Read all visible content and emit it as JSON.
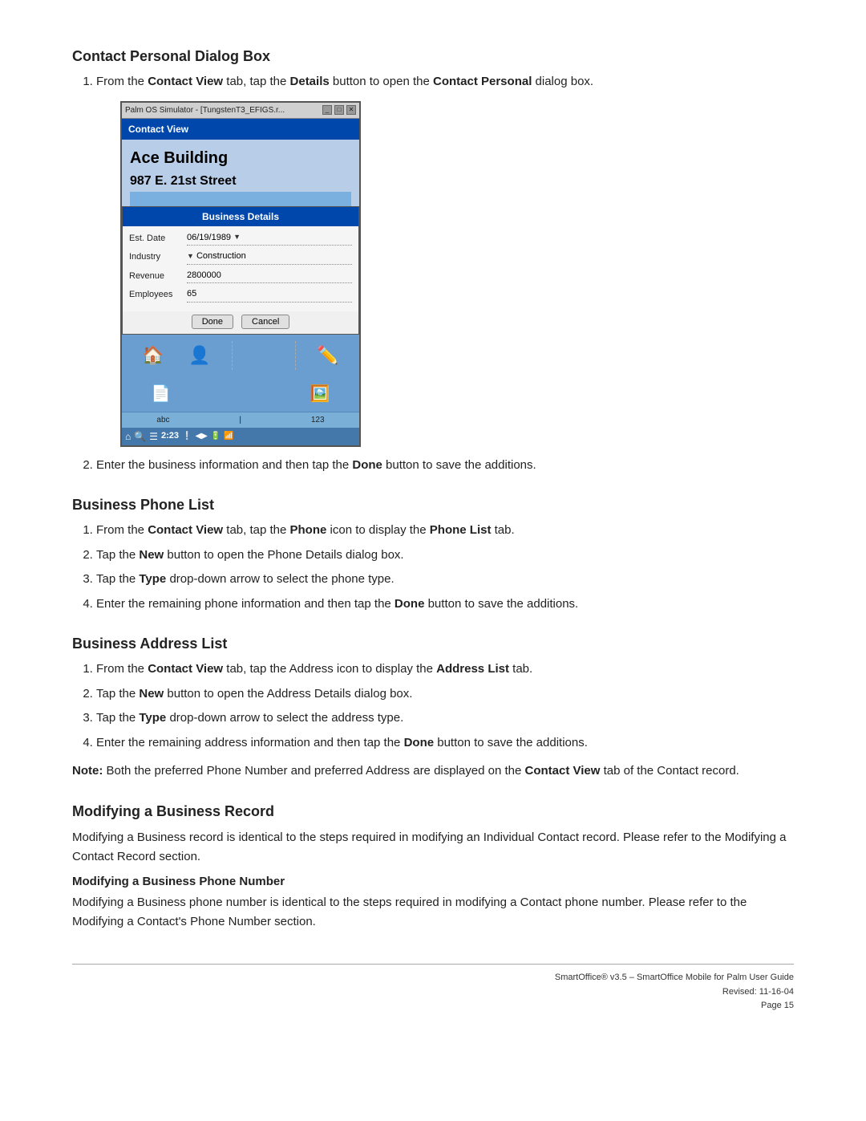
{
  "sections": {
    "contact_personal_dialog": {
      "title": "Contact Personal Dialog Box",
      "steps": [
        {
          "text_before": "From the ",
          "bold1": "Contact View",
          "text_mid1": " tab, tap the ",
          "bold2": "Details",
          "text_mid2": " button to open the ",
          "bold3": "Contact Personal",
          "text_after": " dialog box."
        },
        {
          "text": "Enter the business information and then tap the ",
          "bold": "Done",
          "text_after": " button to save the additions."
        }
      ]
    },
    "business_phone_list": {
      "title": "Business Phone List",
      "steps": [
        {
          "text": "From the ",
          "bold1": "Contact View",
          "text_mid": " tab, tap the ",
          "bold2": "Phone",
          "text_mid2": " icon to display the ",
          "bold3": "Phone List",
          "text_after": " tab."
        },
        {
          "text": "Tap the ",
          "bold": "New",
          "text_after": " button to open the Phone Details dialog box."
        },
        {
          "text": "Tap the ",
          "bold": "Type",
          "text_after": " drop-down arrow to select the phone type."
        },
        {
          "text": "Enter the remaining phone information and then tap the ",
          "bold": "Done",
          "text_after": " button to save the additions."
        }
      ]
    },
    "business_address_list": {
      "title": "Business Address List",
      "steps": [
        {
          "text": "From the ",
          "bold1": "Contact View",
          "text_mid": " tab, tap the Address icon to display the ",
          "bold2": "Address List",
          "text_after": " tab."
        },
        {
          "text": "Tap the ",
          "bold": "New",
          "text_after": " button to open the Address Details dialog box."
        },
        {
          "text": "Tap the ",
          "bold": "Type",
          "text_after": " drop-down arrow to select the address type."
        },
        {
          "text": "Enter the remaining address information and then tap the ",
          "bold": "Done",
          "text_after": " button to save the additions."
        }
      ],
      "note": {
        "label": "Note:",
        "text": " Both the preferred Phone Number and preferred Address are displayed on the ",
        "bold": "Contact View",
        "text_after": " tab of the Contact record."
      }
    },
    "modifying_business_record": {
      "title": "Modifying a Business Record",
      "body": "Modifying a Business record is identical to the steps required in modifying an Individual Contact record. Please refer to the Modifying a Contact Record section.",
      "subsection": {
        "title": "Modifying a Business Phone Number",
        "body": "Modifying a Business phone number is identical to the steps required in modifying a Contact phone number. Please refer to the Modifying a Contact's Phone Number section."
      }
    }
  },
  "palm_simulator": {
    "titlebar": "Palm OS Simulator - [TungstenT3_EFIGS.r...",
    "tab": "Contact View",
    "contact_name": "Ace Building",
    "contact_address": "987 E. 21st Street",
    "contact_city": "▄▄▄▄▄▄▄▄▄▄▄▄",
    "dialog": {
      "title": "Business Details",
      "fields": [
        {
          "label": "Est. Date",
          "value": "06/19/1989",
          "has_arrow": true
        },
        {
          "label": "Industry",
          "value": "Construction",
          "has_arrow": true
        },
        {
          "label": "Revenue",
          "value": "2800000"
        },
        {
          "label": "Employees",
          "value": "65"
        }
      ],
      "buttons": [
        "Done",
        "Cancel"
      ]
    },
    "abc_label": "abc",
    "num_label": "123",
    "time": "2:23",
    "status_color": "#3366aa"
  },
  "footer": {
    "line1": "SmartOffice® v3.5 – SmartOffice Mobile for Palm User Guide",
    "line2": "Revised: 11-16-04",
    "line3": "Page 15"
  }
}
